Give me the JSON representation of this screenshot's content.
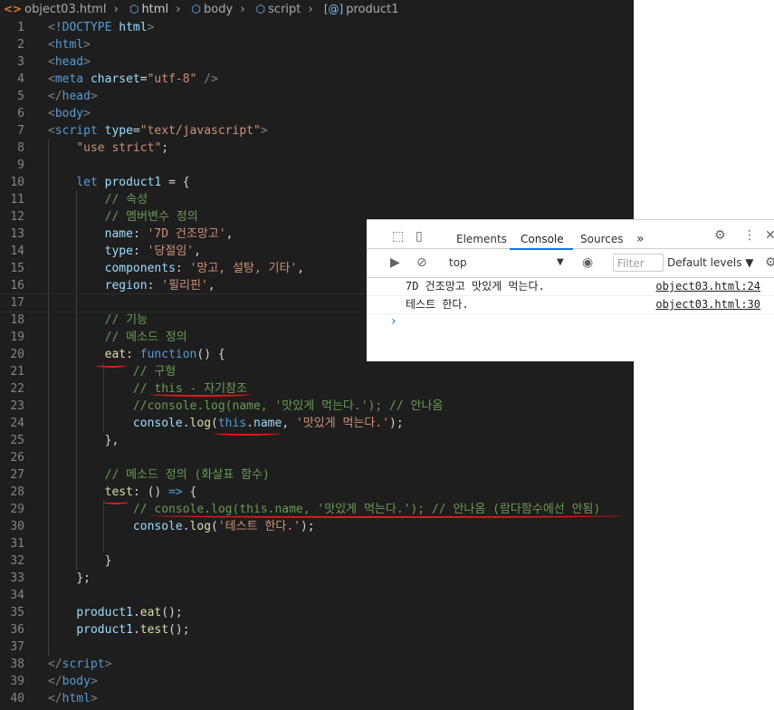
{
  "breadcrumb": {
    "file": "object03.html",
    "items": [
      "html",
      "body",
      "script",
      "product1"
    ]
  },
  "editor": {
    "lines": [
      {
        "n": "1"
      },
      {
        "n": "2"
      },
      {
        "n": "3"
      },
      {
        "n": "4"
      },
      {
        "n": "5"
      },
      {
        "n": "6"
      },
      {
        "n": "7"
      },
      {
        "n": "8"
      },
      {
        "n": "9"
      },
      {
        "n": "10"
      },
      {
        "n": "11"
      },
      {
        "n": "12"
      },
      {
        "n": "13"
      },
      {
        "n": "14"
      },
      {
        "n": "15"
      },
      {
        "n": "16"
      },
      {
        "n": "17"
      },
      {
        "n": "18"
      },
      {
        "n": "19"
      },
      {
        "n": "20"
      },
      {
        "n": "21"
      },
      {
        "n": "22"
      },
      {
        "n": "23"
      },
      {
        "n": "24"
      },
      {
        "n": "25"
      },
      {
        "n": "26"
      },
      {
        "n": "27"
      },
      {
        "n": "28"
      },
      {
        "n": "29"
      },
      {
        "n": "30"
      },
      {
        "n": "31"
      },
      {
        "n": "32"
      },
      {
        "n": "33"
      },
      {
        "n": "34"
      },
      {
        "n": "35"
      },
      {
        "n": "36"
      },
      {
        "n": "37"
      },
      {
        "n": "38"
      },
      {
        "n": "39"
      },
      {
        "n": "40"
      }
    ]
  },
  "devtools": {
    "tabs": [
      "Elements",
      "Console",
      "Sources",
      "»"
    ],
    "context": "top",
    "filter_placeholder": "Filter",
    "levels": "Default levels ▼",
    "logs": [
      {
        "msg": "7D 건조망고 맛있게 먹는다.",
        "src": "object03.html:24"
      },
      {
        "msg": "테스트 한다.",
        "src": "object03.html:30"
      }
    ],
    "prompt": "›"
  },
  "colors": {
    "editor_bg": "#1e1e1e",
    "accent": "#1a73e8",
    "annotation": "#e31a1a"
  }
}
